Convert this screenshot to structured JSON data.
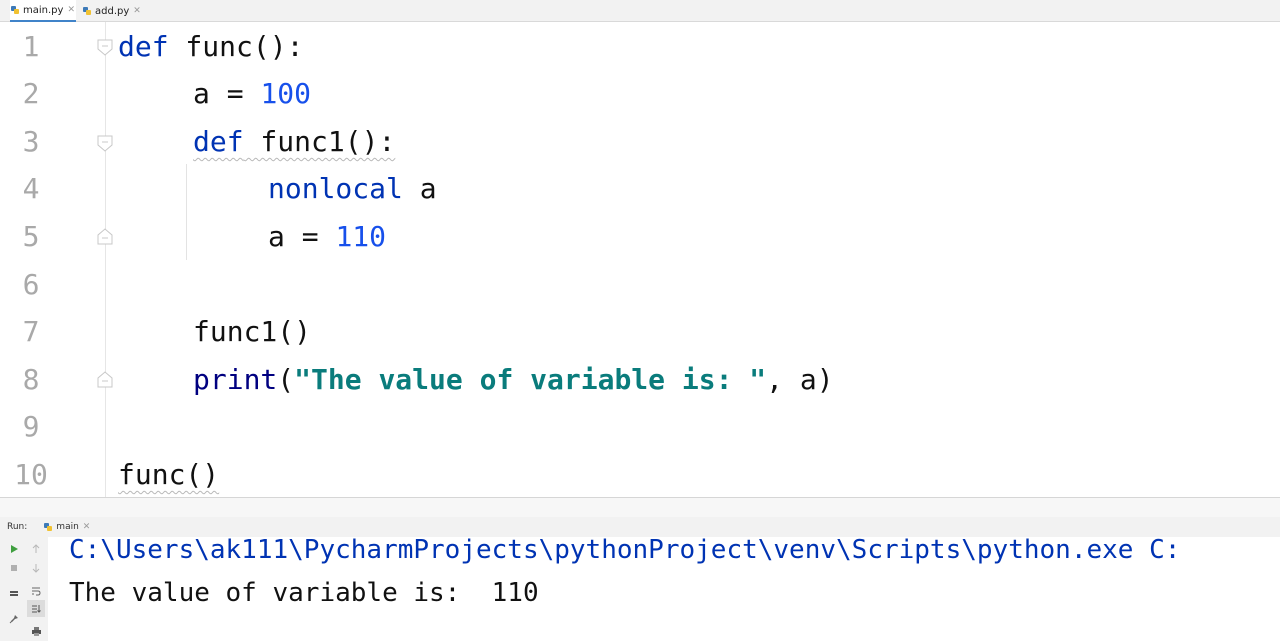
{
  "tabs": [
    {
      "label": "main.py",
      "active": true
    },
    {
      "label": "add.py",
      "active": false
    }
  ],
  "editor": {
    "line_numbers": [
      "1",
      "2",
      "3",
      "4",
      "5",
      "6",
      "7",
      "8",
      "9",
      "10"
    ],
    "lines": {
      "l1_kw": "def",
      "l1_rest": " func():",
      "l2_a": "a = ",
      "l2_num": "100",
      "l3_kw": "def",
      "l3_rest": " func1():",
      "l4_kw": "nonlocal",
      "l4_rest": " a",
      "l5_a": "a = ",
      "l5_num": "110",
      "l7": "func1()",
      "l8_fn": "print",
      "l8_open": "(",
      "l8_str": "\"The value of variable is: \"",
      "l8_rest": ", a)",
      "l10": "func()"
    }
  },
  "run_panel": {
    "label": "Run:",
    "config_tab": "main",
    "console": {
      "command": "C:\\Users\\ak111\\PycharmProjects\\pythonProject\\venv\\Scripts\\python.exe C:",
      "output": "The value of variable is:  110"
    }
  },
  "colors": {
    "keyword": "#0033b3",
    "number": "#1750eb",
    "string": "#0a7c7c",
    "line_number": "#a9a9a9",
    "active_tab_underline": "#4083c9",
    "run_green": "#3f9f3f"
  },
  "icons": {
    "tab_file": "python-file-icon",
    "run": "run-icon",
    "stop": "stop-icon",
    "rerun": "rerun-icon",
    "up": "arrow-up-icon",
    "down": "arrow-down-icon",
    "wrap": "soft-wrap-icon",
    "scroll": "scroll-to-end-icon",
    "pin": "pin-icon",
    "print": "print-icon"
  }
}
